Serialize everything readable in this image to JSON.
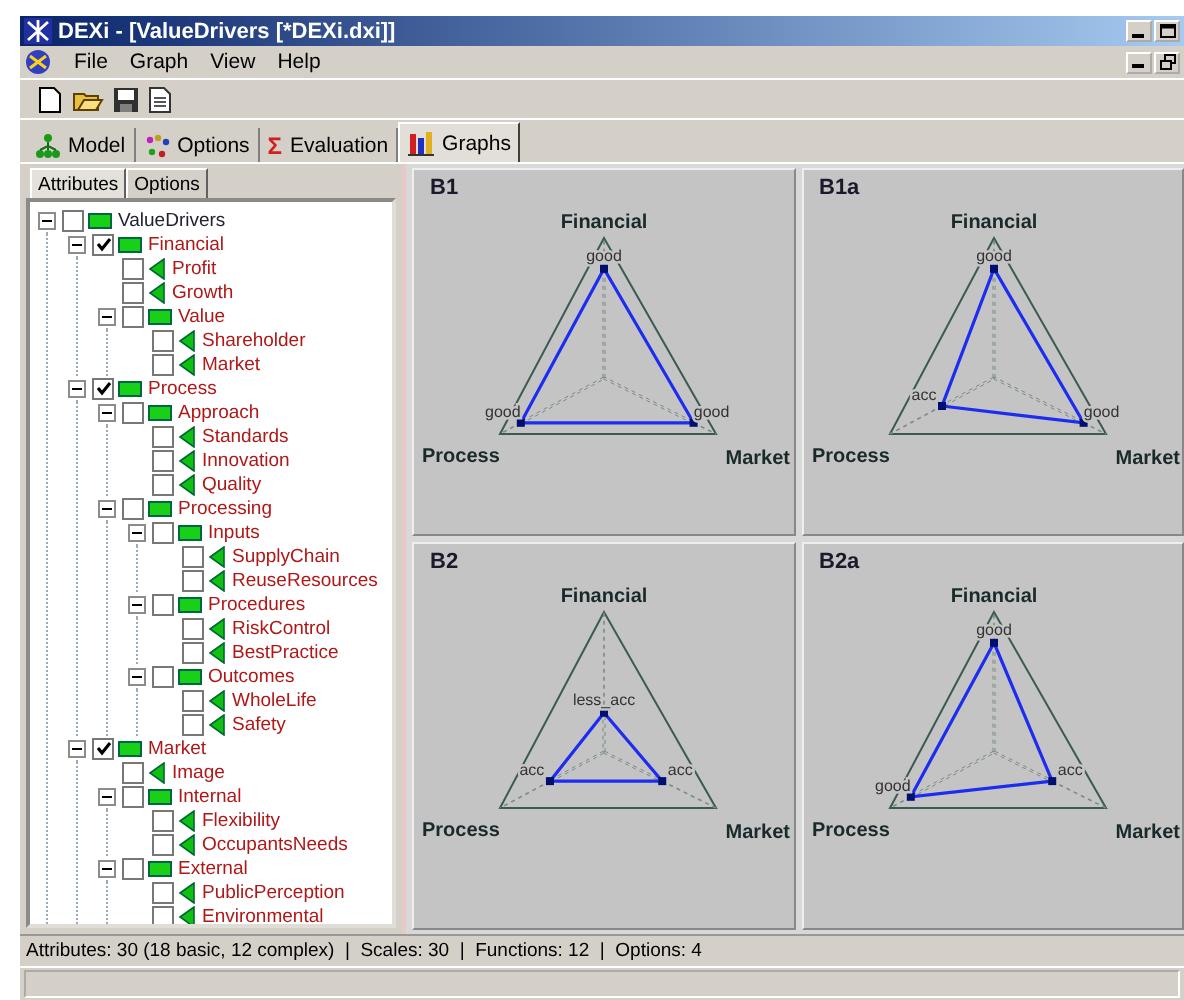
{
  "window": {
    "title": "DEXi - [ValueDrivers [*DEXi.dxi]]"
  },
  "menu": [
    "File",
    "Graph",
    "View",
    "Help"
  ],
  "tabs": [
    {
      "kind": "model",
      "label": "Model",
      "selected": false
    },
    {
      "kind": "options",
      "label": "Options",
      "selected": false
    },
    {
      "kind": "evaluation",
      "icon_text": "Σ",
      "label": "Evaluation",
      "selected": false
    },
    {
      "kind": "graphs",
      "label": "Graphs",
      "selected": true
    }
  ],
  "subtabs": [
    {
      "label": "Attributes",
      "selected": true
    },
    {
      "label": "Options",
      "selected": false
    }
  ],
  "attributes_tree": [
    {
      "label": "ValueDrivers",
      "checked": false,
      "expanded": true,
      "children": [
        {
          "label": "Financial",
          "checked": true,
          "expanded": true,
          "children": [
            {
              "label": "Profit",
              "checked": false
            },
            {
              "label": "Growth",
              "checked": false
            },
            {
              "label": "Value",
              "checked": false,
              "expanded": true,
              "children": [
                {
                  "label": "Shareholder",
                  "checked": false
                },
                {
                  "label": "Market",
                  "checked": false
                }
              ]
            }
          ]
        },
        {
          "label": "Process",
          "checked": true,
          "expanded": true,
          "children": [
            {
              "label": "Approach",
              "checked": false,
              "expanded": true,
              "children": [
                {
                  "label": "Standards",
                  "checked": false
                },
                {
                  "label": "Innovation",
                  "checked": false
                },
                {
                  "label": "Quality",
                  "checked": false
                }
              ]
            },
            {
              "label": "Processing",
              "checked": false,
              "expanded": true,
              "children": [
                {
                  "label": "Inputs",
                  "checked": false,
                  "expanded": true,
                  "children": [
                    {
                      "label": "SupplyChain",
                      "checked": false
                    },
                    {
                      "label": "ReuseResources",
                      "checked": false
                    }
                  ]
                },
                {
                  "label": "Procedures",
                  "checked": false,
                  "expanded": true,
                  "children": [
                    {
                      "label": "RiskControl",
                      "checked": false
                    },
                    {
                      "label": "BestPractice",
                      "checked": false
                    }
                  ]
                },
                {
                  "label": "Outcomes",
                  "checked": false,
                  "expanded": true,
                  "children": [
                    {
                      "label": "WholeLife",
                      "checked": false
                    },
                    {
                      "label": "Safety",
                      "checked": false
                    }
                  ]
                }
              ]
            }
          ]
        },
        {
          "label": "Market",
          "checked": true,
          "expanded": true,
          "children": [
            {
              "label": "Image",
              "checked": false
            },
            {
              "label": "Internal",
              "checked": false,
              "expanded": true,
              "children": [
                {
                  "label": "Flexibility",
                  "checked": false
                },
                {
                  "label": "OccupantsNeeds",
                  "checked": false
                }
              ]
            },
            {
              "label": "External",
              "checked": false,
              "expanded": true,
              "children": [
                {
                  "label": "PublicPerception",
                  "checked": false
                },
                {
                  "label": "Environmental",
                  "checked": false
                }
              ]
            }
          ]
        }
      ]
    }
  ],
  "graphs": [
    {
      "title": "B1",
      "axes": [
        {
          "label": "Financial",
          "value": "good",
          "level": 0.78
        },
        {
          "label": "Process",
          "value": "good",
          "level": 0.8
        },
        {
          "label": "Market",
          "value": "good",
          "level": 0.8
        }
      ]
    },
    {
      "title": "B1a",
      "axes": [
        {
          "label": "Financial",
          "value": "good",
          "level": 0.78
        },
        {
          "label": "Process",
          "value": "acc",
          "level": 0.5
        },
        {
          "label": "Market",
          "value": "good",
          "level": 0.8
        }
      ]
    },
    {
      "title": "B2",
      "axes": [
        {
          "label": "Financial",
          "value": "less_acc",
          "level": 0.28
        },
        {
          "label": "Process",
          "value": "acc",
          "level": 0.52
        },
        {
          "label": "Market",
          "value": "acc",
          "level": 0.52
        }
      ]
    },
    {
      "title": "B2a",
      "axes": [
        {
          "label": "Financial",
          "value": "good",
          "level": 0.78
        },
        {
          "label": "Process",
          "value": "good",
          "level": 0.8
        },
        {
          "label": "Market",
          "value": "acc",
          "level": 0.52
        }
      ]
    }
  ],
  "status_bar": "Attributes: 30 (18 basic, 12 complex)  |  Scales: 30  |  Functions: 12  |  Options: 4"
}
